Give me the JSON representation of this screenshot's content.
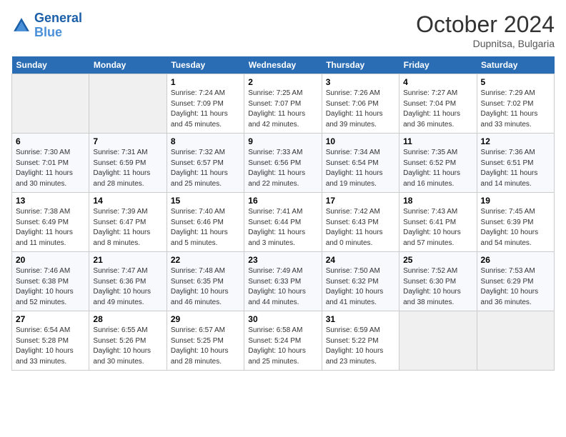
{
  "header": {
    "logo_line1": "General",
    "logo_line2": "Blue",
    "month": "October 2024",
    "location": "Dupnitsa, Bulgaria"
  },
  "weekdays": [
    "Sunday",
    "Monday",
    "Tuesday",
    "Wednesday",
    "Thursday",
    "Friday",
    "Saturday"
  ],
  "weeks": [
    [
      {
        "day": "",
        "info": ""
      },
      {
        "day": "",
        "info": ""
      },
      {
        "day": "1",
        "info": "Sunrise: 7:24 AM\nSunset: 7:09 PM\nDaylight: 11 hours and 45 minutes."
      },
      {
        "day": "2",
        "info": "Sunrise: 7:25 AM\nSunset: 7:07 PM\nDaylight: 11 hours and 42 minutes."
      },
      {
        "day": "3",
        "info": "Sunrise: 7:26 AM\nSunset: 7:06 PM\nDaylight: 11 hours and 39 minutes."
      },
      {
        "day": "4",
        "info": "Sunrise: 7:27 AM\nSunset: 7:04 PM\nDaylight: 11 hours and 36 minutes."
      },
      {
        "day": "5",
        "info": "Sunrise: 7:29 AM\nSunset: 7:02 PM\nDaylight: 11 hours and 33 minutes."
      }
    ],
    [
      {
        "day": "6",
        "info": "Sunrise: 7:30 AM\nSunset: 7:01 PM\nDaylight: 11 hours and 30 minutes."
      },
      {
        "day": "7",
        "info": "Sunrise: 7:31 AM\nSunset: 6:59 PM\nDaylight: 11 hours and 28 minutes."
      },
      {
        "day": "8",
        "info": "Sunrise: 7:32 AM\nSunset: 6:57 PM\nDaylight: 11 hours and 25 minutes."
      },
      {
        "day": "9",
        "info": "Sunrise: 7:33 AM\nSunset: 6:56 PM\nDaylight: 11 hours and 22 minutes."
      },
      {
        "day": "10",
        "info": "Sunrise: 7:34 AM\nSunset: 6:54 PM\nDaylight: 11 hours and 19 minutes."
      },
      {
        "day": "11",
        "info": "Sunrise: 7:35 AM\nSunset: 6:52 PM\nDaylight: 11 hours and 16 minutes."
      },
      {
        "day": "12",
        "info": "Sunrise: 7:36 AM\nSunset: 6:51 PM\nDaylight: 11 hours and 14 minutes."
      }
    ],
    [
      {
        "day": "13",
        "info": "Sunrise: 7:38 AM\nSunset: 6:49 PM\nDaylight: 11 hours and 11 minutes."
      },
      {
        "day": "14",
        "info": "Sunrise: 7:39 AM\nSunset: 6:47 PM\nDaylight: 11 hours and 8 minutes."
      },
      {
        "day": "15",
        "info": "Sunrise: 7:40 AM\nSunset: 6:46 PM\nDaylight: 11 hours and 5 minutes."
      },
      {
        "day": "16",
        "info": "Sunrise: 7:41 AM\nSunset: 6:44 PM\nDaylight: 11 hours and 3 minutes."
      },
      {
        "day": "17",
        "info": "Sunrise: 7:42 AM\nSunset: 6:43 PM\nDaylight: 11 hours and 0 minutes."
      },
      {
        "day": "18",
        "info": "Sunrise: 7:43 AM\nSunset: 6:41 PM\nDaylight: 10 hours and 57 minutes."
      },
      {
        "day": "19",
        "info": "Sunrise: 7:45 AM\nSunset: 6:39 PM\nDaylight: 10 hours and 54 minutes."
      }
    ],
    [
      {
        "day": "20",
        "info": "Sunrise: 7:46 AM\nSunset: 6:38 PM\nDaylight: 10 hours and 52 minutes."
      },
      {
        "day": "21",
        "info": "Sunrise: 7:47 AM\nSunset: 6:36 PM\nDaylight: 10 hours and 49 minutes."
      },
      {
        "day": "22",
        "info": "Sunrise: 7:48 AM\nSunset: 6:35 PM\nDaylight: 10 hours and 46 minutes."
      },
      {
        "day": "23",
        "info": "Sunrise: 7:49 AM\nSunset: 6:33 PM\nDaylight: 10 hours and 44 minutes."
      },
      {
        "day": "24",
        "info": "Sunrise: 7:50 AM\nSunset: 6:32 PM\nDaylight: 10 hours and 41 minutes."
      },
      {
        "day": "25",
        "info": "Sunrise: 7:52 AM\nSunset: 6:30 PM\nDaylight: 10 hours and 38 minutes."
      },
      {
        "day": "26",
        "info": "Sunrise: 7:53 AM\nSunset: 6:29 PM\nDaylight: 10 hours and 36 minutes."
      }
    ],
    [
      {
        "day": "27",
        "info": "Sunrise: 6:54 AM\nSunset: 5:28 PM\nDaylight: 10 hours and 33 minutes."
      },
      {
        "day": "28",
        "info": "Sunrise: 6:55 AM\nSunset: 5:26 PM\nDaylight: 10 hours and 30 minutes."
      },
      {
        "day": "29",
        "info": "Sunrise: 6:57 AM\nSunset: 5:25 PM\nDaylight: 10 hours and 28 minutes."
      },
      {
        "day": "30",
        "info": "Sunrise: 6:58 AM\nSunset: 5:24 PM\nDaylight: 10 hours and 25 minutes."
      },
      {
        "day": "31",
        "info": "Sunrise: 6:59 AM\nSunset: 5:22 PM\nDaylight: 10 hours and 23 minutes."
      },
      {
        "day": "",
        "info": ""
      },
      {
        "day": "",
        "info": ""
      }
    ]
  ]
}
